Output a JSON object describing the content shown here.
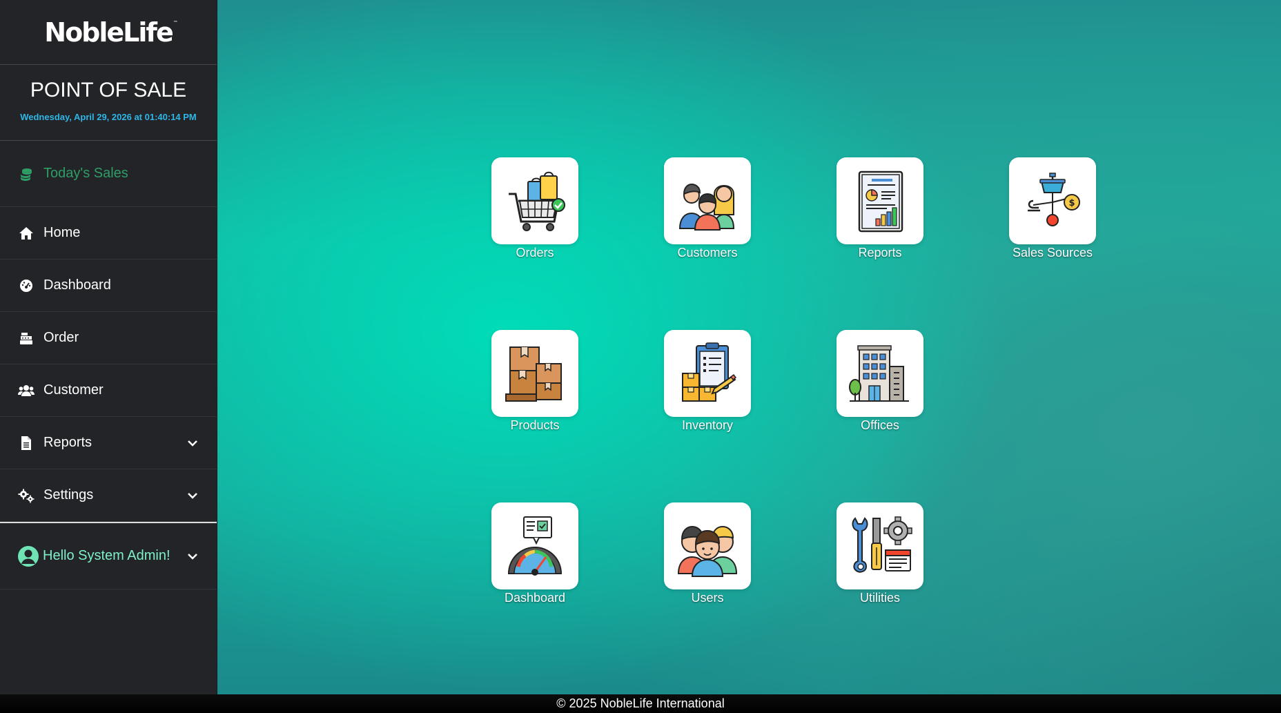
{
  "brand": {
    "logo_text": "NobleLife",
    "tm": "™"
  },
  "header": {
    "title": "POINT OF SALE",
    "datetime": "Wednesday, April 29, 2026 at 01:40:14 PM"
  },
  "sidebar": {
    "items": [
      {
        "label": "Today's Sales",
        "icon": "coins-icon",
        "active": true
      },
      {
        "label": "Home",
        "icon": "home-icon"
      },
      {
        "label": "Dashboard",
        "icon": "gauge-icon"
      },
      {
        "label": "Order",
        "icon": "cash-register-icon"
      },
      {
        "label": "Customer",
        "icon": "users-icon"
      },
      {
        "label": "Reports",
        "icon": "file-icon",
        "expandable": true
      },
      {
        "label": "Settings",
        "icon": "gears-icon",
        "expandable": true
      }
    ],
    "user": {
      "greeting": "Hello System Admin!",
      "icon": "user-circle-icon"
    }
  },
  "tiles": [
    {
      "label": "Orders",
      "icon": "shopping-cart-icon"
    },
    {
      "label": "Customers",
      "icon": "customers-group-icon"
    },
    {
      "label": "Reports",
      "icon": "report-chart-icon"
    },
    {
      "label": "Sales Sources",
      "icon": "sales-sources-icon"
    },
    {
      "label": "Products",
      "icon": "boxes-icon"
    },
    {
      "label": "Inventory",
      "icon": "clipboard-inventory-icon"
    },
    {
      "label": "Offices",
      "icon": "office-building-icon"
    },
    {
      "label": "Dashboard",
      "icon": "speedometer-icon"
    },
    {
      "label": "Users",
      "icon": "users-faces-icon"
    },
    {
      "label": "Utilities",
      "icon": "tools-icon"
    }
  ],
  "footer": {
    "text": "© 2025 NobleLife International"
  },
  "colors": {
    "sidebar_bg": "#222428",
    "active_green": "#2f9e66",
    "date_blue": "#2fb6e6",
    "teal_accent": "#00dcb8",
    "user_green": "#7ff0c8"
  }
}
